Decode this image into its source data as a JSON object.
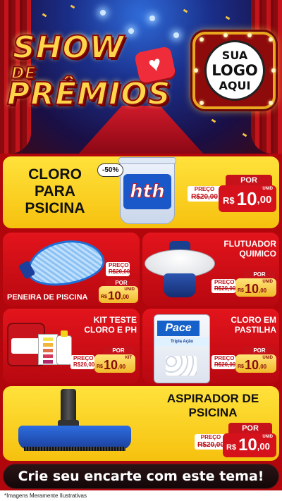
{
  "header": {
    "title_line1": "SHOW",
    "title_line2": "DE",
    "title_line3": "PRÊMIOS",
    "heart_symbol": "♥",
    "logo": {
      "line1": "SUA",
      "line2": "LOGO",
      "line3": "AQUI"
    }
  },
  "products": [
    {
      "title": "CLORO\nPARA\nPSICINA",
      "brand": "hth",
      "discount": "-50%",
      "old_label": "PREÇO",
      "old_price": "R$20,00",
      "por_label": "POR",
      "currency": "R$",
      "price_int": "10",
      "price_cents": ",00",
      "unit": "UNID"
    },
    {
      "title": "PENEIRA DE PISCINA",
      "old_label": "PREÇO",
      "old_price": "R$20,00",
      "por_label": "POR",
      "currency": "R$",
      "price_int": "10",
      "price_cents": ",00",
      "unit": "UNID"
    },
    {
      "title": "FLUTUADOR\nQUIMICO",
      "old_label": "PREÇO",
      "old_price": "R$20,00",
      "por_label": "POR",
      "currency": "R$",
      "price_int": "10",
      "price_cents": ",00",
      "unit": "UNID"
    },
    {
      "title": "KIT TESTE\nCLORO E PH",
      "old_label": "PREÇO",
      "old_price": "R$20,00",
      "por_label": "POR",
      "currency": "R$",
      "price_int": "10",
      "price_cents": ",00",
      "unit": "KIT"
    },
    {
      "title": "CLORO EM\nPASTILHA",
      "brand": "Pace",
      "brand_sub": "Tripla Ação",
      "old_label": "PREÇO",
      "old_price": "R$20,00",
      "por_label": "POR",
      "currency": "R$",
      "price_int": "10",
      "price_cents": ",00",
      "unit": "UNID"
    },
    {
      "title": "ASPIRADOR DE\nPSICINA",
      "old_label": "PREÇO",
      "old_price": "R$20,00",
      "por_label": "POR",
      "currency": "R$",
      "price_int": "10",
      "price_cents": ",00",
      "unit": "UNID"
    }
  ],
  "cta": "Crie seu encarte com este tema!",
  "disclaimer": "*Imagens Meramente Ilustrativas",
  "colors": {
    "yellow_card": "#ffe23b",
    "red_card": "#e3141c",
    "price_red": "#d5121b",
    "price_gold": "#f1b82a",
    "cta_bg": "#1e0d0f"
  }
}
